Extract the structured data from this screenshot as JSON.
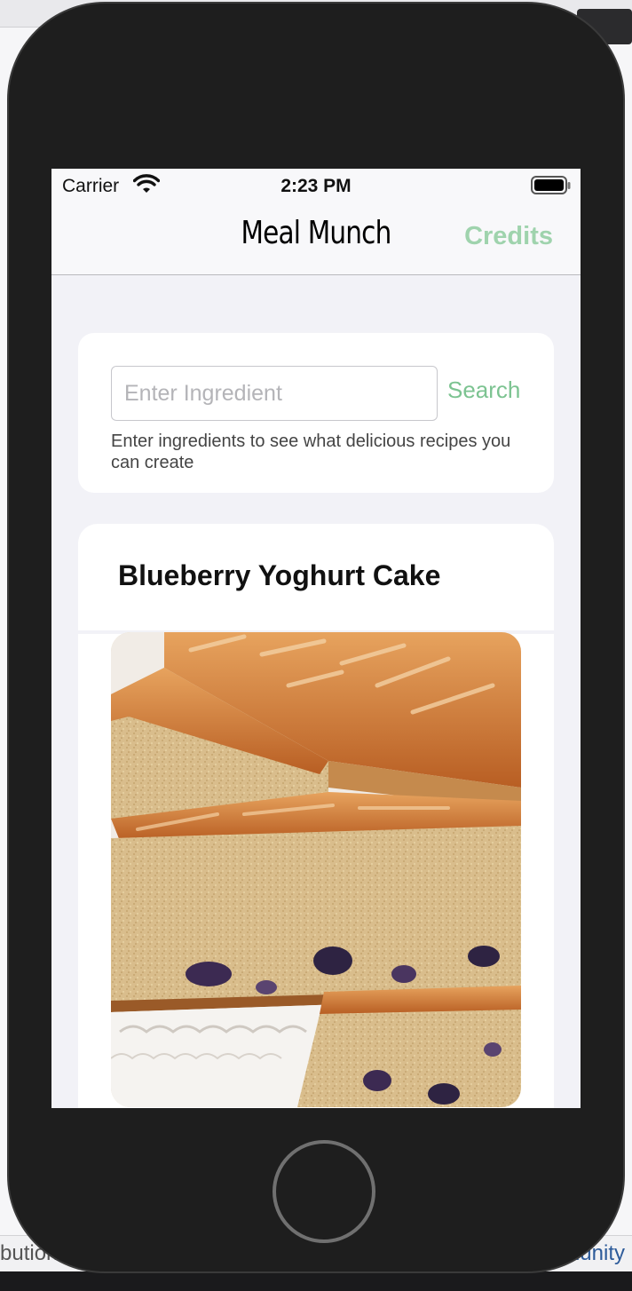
{
  "background": {
    "bottom_left_text": "butions",
    "bottom_right_link": "munity"
  },
  "status_bar": {
    "carrier": "Carrier",
    "time": "2:23 PM"
  },
  "nav": {
    "title": "Meal Munch",
    "credits_label": "Credits"
  },
  "search": {
    "placeholder": "Enter Ingredient",
    "value": "",
    "button_label": "Search",
    "helper_text": "Enter ingredients to see what delicious recipes you can create"
  },
  "recipe": {
    "title": "Blueberry Yoghurt Cake",
    "image_alt": "cake-photo"
  },
  "colors": {
    "accent_green": "#7cc391",
    "credits_green": "#9fd3ad",
    "screen_bg": "#f2f2f7",
    "phone_body": "#1e1e1e"
  }
}
